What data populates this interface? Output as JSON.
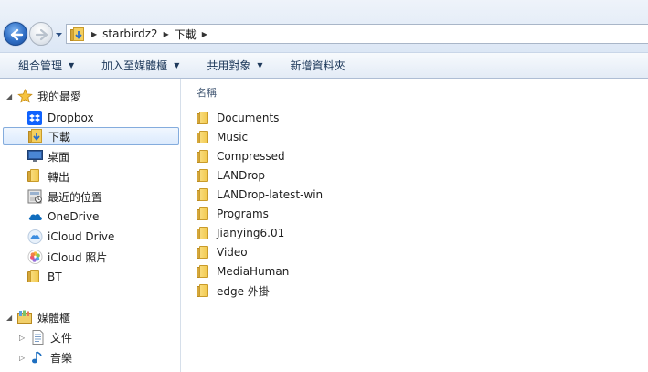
{
  "address_bar": {
    "path": [
      "starbirdz2",
      "下載"
    ]
  },
  "toolbar": {
    "organize": "組合管理",
    "include_in_library": "加入至媒體櫃",
    "share_with": "共用對象",
    "new_folder": "新增資料夾"
  },
  "nav_pane": {
    "favorites": {
      "label": "我的最愛",
      "items": [
        {
          "label": "Dropbox",
          "icon": "dropbox-icon"
        },
        {
          "label": "下載",
          "icon": "downloads-folder-icon",
          "selected": true
        },
        {
          "label": "桌面",
          "icon": "desktop-icon"
        },
        {
          "label": "轉出",
          "icon": "folder-icon"
        },
        {
          "label": "最近的位置",
          "icon": "recent-places-icon"
        },
        {
          "label": "OneDrive",
          "icon": "onedrive-icon"
        },
        {
          "label": "iCloud Drive",
          "icon": "icloud-drive-icon"
        },
        {
          "label": "iCloud 照片",
          "icon": "icloud-photos-icon"
        },
        {
          "label": "BT",
          "icon": "folder-icon"
        }
      ]
    },
    "libraries": {
      "label": "媒體櫃",
      "items": [
        {
          "label": "文件",
          "icon": "documents-library-icon"
        },
        {
          "label": "音樂",
          "icon": "music-library-icon"
        }
      ]
    }
  },
  "content": {
    "column_header": "名稱",
    "files": [
      "Documents",
      "Music",
      "Compressed",
      "LANDrop",
      "LANDrop-latest-win",
      "Programs",
      "Jianying6.01",
      "Video",
      "MediaHuman",
      "edge 外掛"
    ]
  },
  "colors": {
    "selection_border": "#84acdd",
    "toolbar_text": "#1e395b",
    "folder_yellow": "#f2c94c"
  }
}
